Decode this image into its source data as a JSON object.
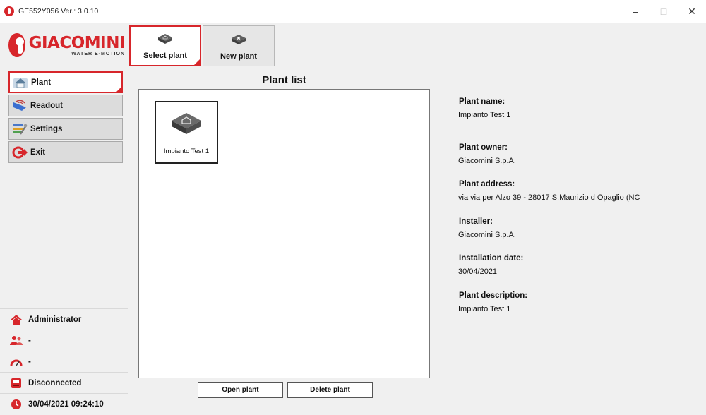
{
  "window": {
    "title": "GE552Y056 Ver.: 3.0.10",
    "minimize": "–",
    "maximize": "□",
    "close": "✕"
  },
  "logo": {
    "name": "GIACOMINI",
    "tagline": "WATER E-MOTION"
  },
  "top_tabs": [
    {
      "label": "Select plant",
      "icon": "plant-folder-icon",
      "active": true
    },
    {
      "label": "New plant",
      "icon": "new-plant-folder-icon",
      "active": false
    }
  ],
  "sidebar": {
    "items": [
      {
        "label": "Plant",
        "icon": "house-icon",
        "active": true
      },
      {
        "label": "Readout",
        "icon": "readout-icon",
        "active": false
      },
      {
        "label": "Settings",
        "icon": "settings-icon",
        "active": false
      },
      {
        "label": "Exit",
        "icon": "exit-icon",
        "active": false
      }
    ],
    "status": {
      "user": "Administrator",
      "group": "-",
      "gauge": "-",
      "connection": "Disconnected",
      "datetime": "30/04/2021 09:24:10"
    }
  },
  "plant_list": {
    "title": "Plant list",
    "items": [
      {
        "label": "Impianto Test 1"
      }
    ],
    "open_button": "Open plant",
    "delete_button": "Delete plant"
  },
  "details": {
    "name_label": "Plant name:",
    "name": "Impianto Test 1",
    "owner_label": "Plant owner:",
    "owner": "Giacomini S.p.A.",
    "address_label": "Plant address:",
    "address": "via via per Alzo 39 - 28017 S.Maurizio d Opaglio (NC",
    "installer_label": "Installer:",
    "installer": "Giacomini S.p.A.",
    "date_label": "Installation date:",
    "date": "30/04/2021",
    "description_label": "Plant description:",
    "description": "Impianto Test 1"
  },
  "colors": {
    "accent": "#d7262b",
    "panel": "#f0f0f0"
  }
}
